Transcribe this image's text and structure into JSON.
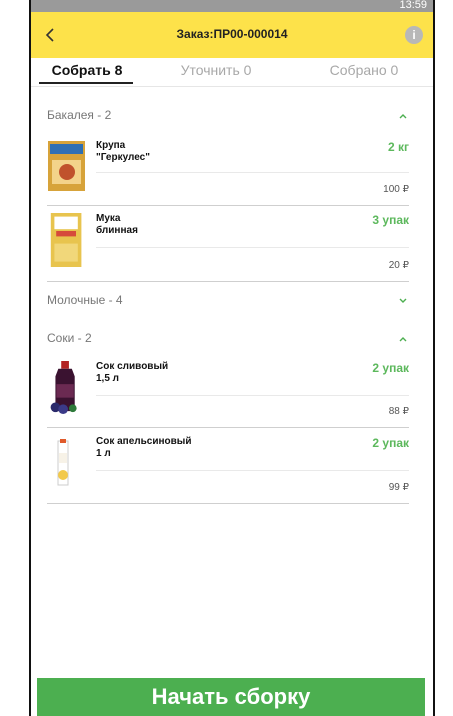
{
  "status_bar": {
    "time": "13:59"
  },
  "header": {
    "title": "Заказ:ПР00-000014"
  },
  "tabs": [
    {
      "label": "Собрать 8"
    },
    {
      "label": "Уточнить 0"
    },
    {
      "label": "Собрано 0"
    }
  ],
  "sections": [
    {
      "name": "Бакалея - 2",
      "expanded": true,
      "items": [
        {
          "name": "Крупа\n\"Геркулес\"",
          "qty": "2 кг",
          "price": "100 ₽",
          "thumb_color": "#d7a33a"
        },
        {
          "name": "Мука\nблинная",
          "qty": "3 упак",
          "price": "20 ₽",
          "thumb_color": "#e8c44e"
        }
      ]
    },
    {
      "name": "Молочные - 4",
      "expanded": false,
      "items": []
    },
    {
      "name": "Соки - 2",
      "expanded": true,
      "items": [
        {
          "name": "Сок сливовый\n1,5 л",
          "qty": "2 упак",
          "price": "88 ₽",
          "thumb_color": "#3a1230"
        },
        {
          "name": "Сок апельсиновый\n1 л",
          "qty": "2 упак",
          "price": "99 ₽",
          "thumb_color": "#f2c94c"
        }
      ]
    }
  ],
  "cta": {
    "label": "Начать сборку"
  },
  "colors": {
    "header": "#fde24a",
    "accent": "#4caf50"
  }
}
